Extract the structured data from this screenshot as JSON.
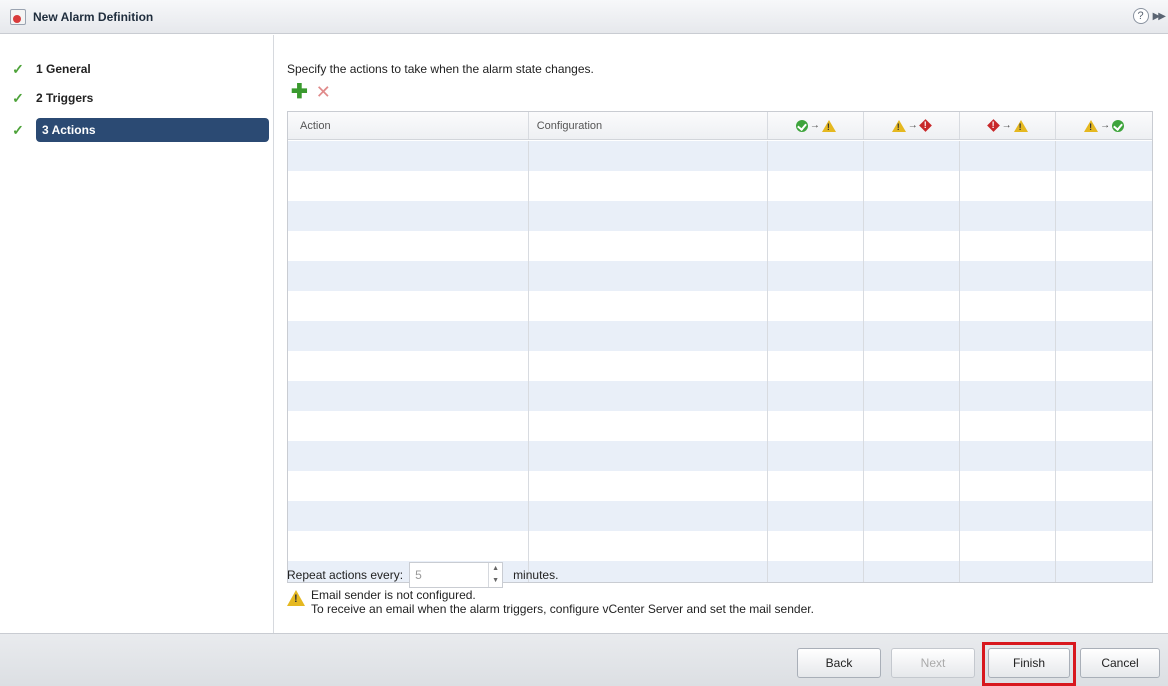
{
  "window": {
    "title": "New Alarm Definition",
    "help_glyph": "?",
    "expand_glyph": "▶▶"
  },
  "sidebar": {
    "steps": [
      {
        "label": "1 General",
        "check": "✓"
      },
      {
        "label": "2 Triggers",
        "check": "✓"
      },
      {
        "label": "3 Actions",
        "check": "✓"
      }
    ]
  },
  "main": {
    "instruction": "Specify the actions to take when the alarm state changes.",
    "toolbar": {
      "add_glyph": "✚",
      "remove_glyph": "✕"
    },
    "table": {
      "headers": {
        "action": "Action",
        "configuration": "Configuration"
      },
      "arrow_glyph": "→",
      "state_transitions": [
        {
          "from": "normal",
          "to": "warning"
        },
        {
          "from": "warning",
          "to": "alert"
        },
        {
          "from": "alert",
          "to": "warning"
        },
        {
          "from": "warning",
          "to": "normal"
        }
      ]
    },
    "repeat": {
      "label": "Repeat actions every:",
      "value": "5",
      "unit": "minutes."
    },
    "warning": {
      "line1": "Email sender is not configured.",
      "line2": "To receive an email when the alarm triggers, configure vCenter Server and set the mail sender."
    }
  },
  "footer": {
    "back": "Back",
    "next": "Next",
    "finish": "Finish",
    "cancel": "Cancel"
  },
  "colors": {
    "active_step": "#2b4a73",
    "check": "#4ea33a",
    "highlight": "#d8181e"
  }
}
